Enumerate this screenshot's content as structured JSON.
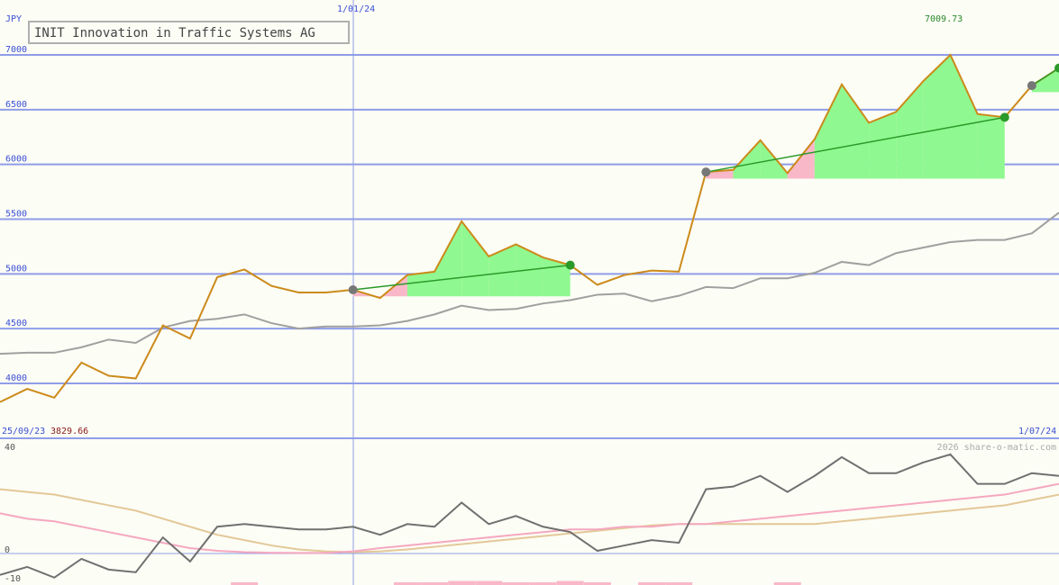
{
  "chart_data": [
    {
      "type": "line",
      "title": "INIT Innovation in Traffic Systems AG",
      "currency": "JPY",
      "x_start_label": "25/09/23",
      "x_end_label": "1/07/24",
      "x_mid_label": "1/01/24",
      "min_label": "3829.66",
      "max_label": "7009.73",
      "ylim": [
        3500,
        7500
      ],
      "yticks": [
        "7000",
        "6500",
        "6000",
        "5500",
        "5000",
        "4500",
        "4000"
      ],
      "ytick_values": [
        7000,
        6500,
        6000,
        5500,
        5000,
        4500,
        4000
      ],
      "grid": true,
      "series": [
        {
          "values": [
            3830,
            3950,
            3870,
            4190,
            4070,
            4045,
            4530,
            4410,
            4970,
            5040,
            4890,
            4830,
            4830,
            4855,
            4780,
            4990,
            5020,
            5480,
            5160,
            5270,
            5150,
            5080,
            4900,
            4990,
            5030,
            5020,
            5930,
            5950,
            6220,
            5920,
            6230,
            6730,
            6380,
            6480,
            6760,
            7000,
            6460,
            6430,
            6720,
            6880
          ]
        },
        {
          "values": [
            4270,
            4280,
            4280,
            4330,
            4400,
            4370,
            4510,
            4570,
            4590,
            4630,
            4550,
            4500,
            4520,
            4520,
            4530,
            4570,
            4630,
            4710,
            4670,
            4680,
            4730,
            4760,
            4810,
            4820,
            4750,
            4800,
            4880,
            4870,
            4960,
            4960,
            5010,
            5110,
            5080,
            5190,
            5240,
            5290,
            5310,
            5310,
            5370,
            5560
          ]
        }
      ],
      "trend_segments": [
        [
          13,
          21
        ],
        [
          26,
          37
        ],
        [
          38,
          39
        ]
      ]
    },
    {
      "type": "line",
      "top_left_label": "40",
      "zero_label": "0",
      "bottom_label": "-10",
      "watermark": "2026 share-o-matic.com",
      "ylim": [
        -12,
        42
      ],
      "series": [
        {
          "values": [
            -8,
            -5,
            -9,
            -2,
            -6,
            -7,
            6,
            -3,
            10,
            11,
            10,
            9,
            9,
            10,
            7,
            11,
            10,
            19,
            11,
            14,
            10,
            8,
            1,
            3,
            5,
            4,
            24,
            25,
            29,
            23,
            29,
            36,
            30,
            30,
            34,
            37,
            26,
            26,
            30,
            29
          ]
        },
        {
          "values": [
            15,
            13,
            12,
            10,
            8,
            6,
            4,
            2,
            1,
            0.5,
            0.3,
            0.2,
            0.2,
            0.8,
            2,
            3,
            4,
            5,
            6,
            7,
            8,
            9,
            9,
            10,
            10,
            11,
            11,
            12,
            13,
            14,
            15,
            16,
            17,
            18,
            19,
            20,
            21,
            22,
            24,
            26
          ]
        },
        {
          "values": [
            24,
            23,
            22,
            20,
            18,
            16,
            13,
            10,
            7,
            5,
            3,
            1.5,
            0.8,
            0.5,
            0.8,
            1.5,
            2.5,
            3.5,
            4.5,
            5.5,
            6.5,
            7.5,
            8.5,
            9.5,
            10.5,
            11,
            11,
            11,
            11,
            11,
            11,
            12,
            13,
            14,
            15,
            16,
            17,
            18,
            20,
            22
          ]
        }
      ],
      "bars": [
        0,
        0,
        0,
        0,
        0,
        0,
        0,
        0,
        0,
        1,
        0,
        0,
        0,
        0,
        0,
        1,
        1,
        1.5,
        1.5,
        1,
        1,
        1.5,
        1,
        0,
        1,
        1,
        0,
        0,
        0,
        1,
        0,
        0,
        0,
        0,
        0,
        0,
        0,
        0,
        0,
        0
      ]
    }
  ],
  "colors": {
    "price": "#cc8a1a",
    "average": "#a0a0a0",
    "gain_fill": "#90f890",
    "loss_fill": "#f8b8c8",
    "trend_line": "#2a9a2a",
    "grid": "#8f9de8",
    "axis_text": "#3b4fd6",
    "max_label": "#2a8a2a",
    "min_label": "#8a1a1a",
    "osc_main": "#707070",
    "osc_pink": "#f5a8c0",
    "osc_tan": "#e3c898",
    "osc_bars": "#f8b8c8"
  }
}
